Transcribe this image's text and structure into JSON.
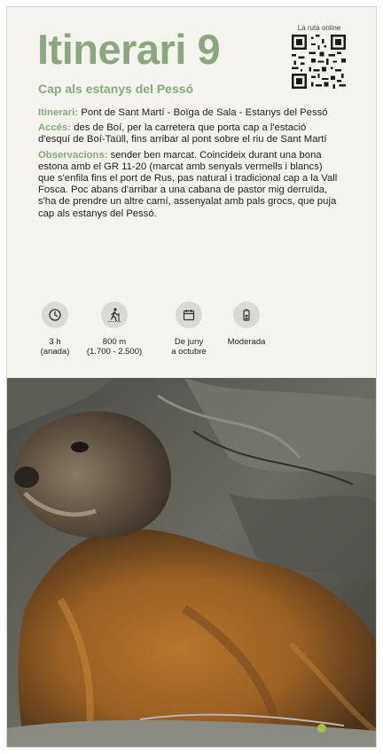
{
  "header": {
    "title": "Itinerari 9",
    "subtitle": "Cap als estanys del Pessó",
    "qr_label": "La ruta online"
  },
  "details": {
    "itinerari_label": "Itinerari:",
    "itinerari_text": "Pont de Sant Martí - Boïga de Sala - Estanys del Pessó",
    "acces_label": "Accés:",
    "acces_text": "des de Boí, per la carretera que porta cap a l'estació d'esquí de Boí-Taüll, fins arribar al pont sobre el riu de Sant Martí",
    "observacions_label": "Observacions:",
    "observacions_text": "sender ben marcat. Coincideix durant una bona estona amb el GR 11-20 (marcat amb senyals vermells i blancs) que s'enfila fins el port de Rus, pas natural i tradicional cap a la Vall Fosca. Poc abans d'arribar a una cabana de pastor mig derruïda, s'ha de prendre un altre camí, assenyalat amb pals grocs, que puja cap als estanys del Pessó."
  },
  "stats": [
    {
      "icon": "clock-icon",
      "line1": "3 h",
      "line2": "(anada)"
    },
    {
      "icon": "hiker-icon",
      "line1": "800 m",
      "line2": "(1.700 - 2.500)"
    },
    {
      "icon": "calendar-icon",
      "line1": "De juny",
      "line2": "a octubre"
    },
    {
      "icon": "battery-difficulty-icon",
      "line1": "Moderada",
      "line2": ""
    }
  ],
  "colors": {
    "accent": "#8ba77f",
    "panel": "#f4f3ee",
    "icon_circle": "#d9d9d6"
  }
}
